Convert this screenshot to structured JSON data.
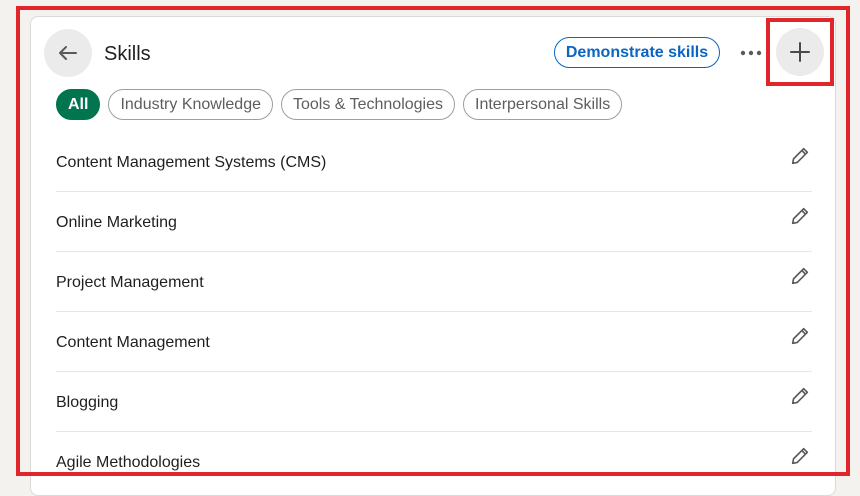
{
  "header": {
    "title": "Skills",
    "demonstrate_label": "Demonstrate skills"
  },
  "icons": {
    "back": "arrow-left-icon",
    "more": "ellipsis-icon",
    "add": "plus-icon",
    "edit": "pencil-icon"
  },
  "filters": [
    {
      "label": "All",
      "selected": true
    },
    {
      "label": "Industry Knowledge",
      "selected": false
    },
    {
      "label": "Tools & Technologies",
      "selected": false
    },
    {
      "label": "Interpersonal Skills",
      "selected": false
    }
  ],
  "skills": [
    {
      "name": "Content Management Systems (CMS)"
    },
    {
      "name": "Online Marketing"
    },
    {
      "name": "Project Management"
    },
    {
      "name": "Content Management"
    },
    {
      "name": "Blogging"
    },
    {
      "name": "Agile Methodologies"
    }
  ],
  "colors": {
    "accent_blue": "#0a66c2",
    "selected_pill": "#01754f",
    "highlight_red": "#e0262a"
  }
}
